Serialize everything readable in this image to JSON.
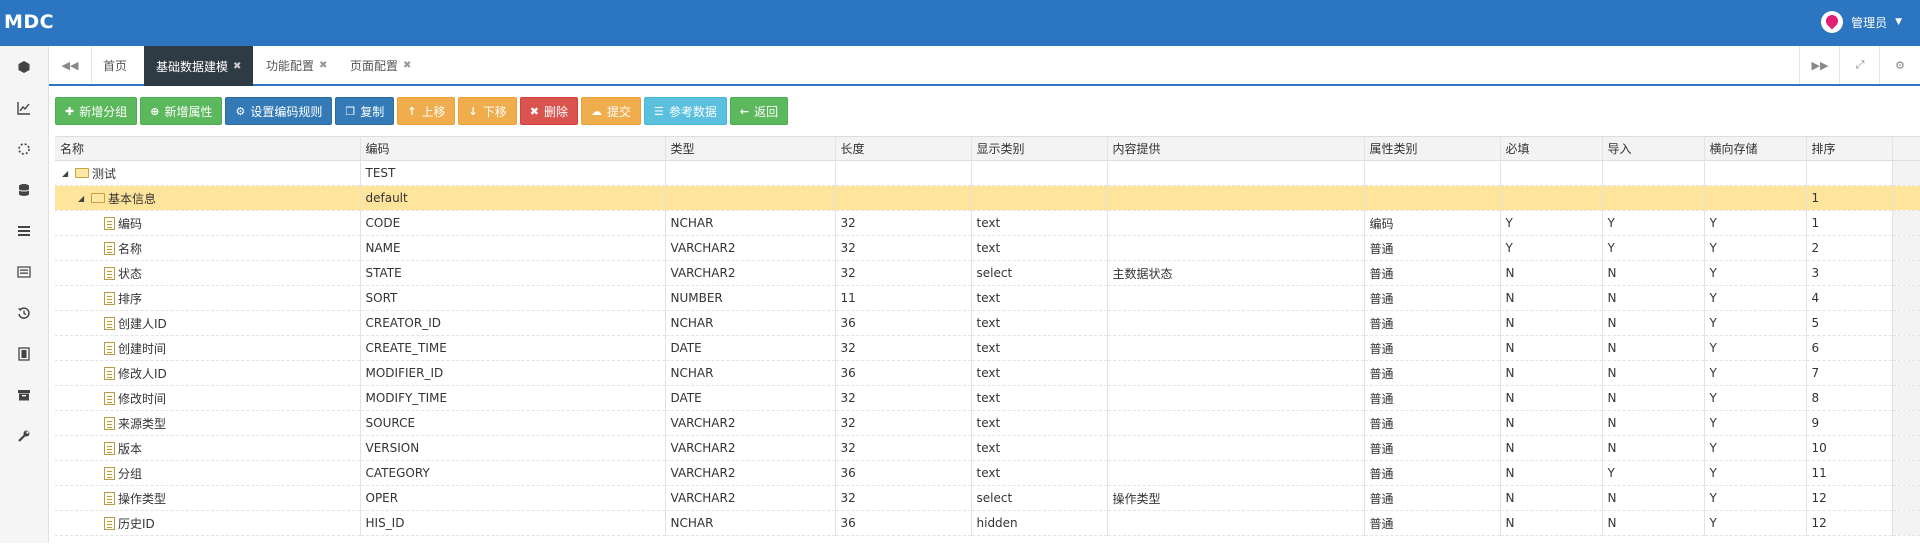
{
  "app": {
    "title": "MDC"
  },
  "user": {
    "name": "管理员",
    "icon": "user-pin-icon"
  },
  "sidebar": {
    "items": [
      {
        "icon": "cube-icon"
      },
      {
        "icon": "line-chart-icon"
      },
      {
        "icon": "spinner-icon"
      },
      {
        "icon": "database-icon"
      },
      {
        "icon": "list-icon"
      },
      {
        "icon": "table-list-icon"
      },
      {
        "icon": "history-icon"
      },
      {
        "icon": "film-icon"
      },
      {
        "icon": "archive-icon"
      },
      {
        "icon": "wrench-icon"
      }
    ]
  },
  "tabs": [
    {
      "label": "首页",
      "closable": false,
      "active": false
    },
    {
      "label": "基础数据建模",
      "closable": true,
      "active": true
    },
    {
      "label": "功能配置",
      "closable": true,
      "active": false
    },
    {
      "label": "页面配置",
      "closable": true,
      "active": false
    }
  ],
  "toolbar": {
    "add_group": "新增分组",
    "add_attr": "新增属性",
    "code_rule": "设置编码规则",
    "copy": "复制",
    "move_up": "上移",
    "move_down": "下移",
    "delete": "删除",
    "submit": "提交",
    "ref_data": "参考数据",
    "back": "返回"
  },
  "grid": {
    "columns": [
      "名称",
      "编码",
      "类型",
      "长度",
      "显示类别",
      "内容提供",
      "属性类别",
      "必填",
      "导入",
      "横向存储",
      "排序"
    ],
    "root": {
      "name": "测试",
      "code": "TEST"
    },
    "group": {
      "name": "基本信息",
      "code": "default",
      "sort": "1"
    },
    "rows": [
      [
        "编码",
        "CODE",
        "NCHAR",
        "32",
        "text",
        "",
        "编码",
        "Y",
        "Y",
        "Y",
        "1"
      ],
      [
        "名称",
        "NAME",
        "VARCHAR2",
        "32",
        "text",
        "",
        "普通",
        "Y",
        "Y",
        "Y",
        "2"
      ],
      [
        "状态",
        "STATE",
        "VARCHAR2",
        "32",
        "select",
        "主数据状态",
        "普通",
        "N",
        "N",
        "Y",
        "3"
      ],
      [
        "排序",
        "SORT",
        "NUMBER",
        "11",
        "text",
        "",
        "普通",
        "N",
        "N",
        "Y",
        "4"
      ],
      [
        "创建人ID",
        "CREATOR_ID",
        "NCHAR",
        "36",
        "text",
        "",
        "普通",
        "N",
        "N",
        "Y",
        "5"
      ],
      [
        "创建时间",
        "CREATE_TIME",
        "DATE",
        "32",
        "text",
        "",
        "普通",
        "N",
        "N",
        "Y",
        "6"
      ],
      [
        "修改人ID",
        "MODIFIER_ID",
        "NCHAR",
        "36",
        "text",
        "",
        "普通",
        "N",
        "N",
        "Y",
        "7"
      ],
      [
        "修改时间",
        "MODIFY_TIME",
        "DATE",
        "32",
        "text",
        "",
        "普通",
        "N",
        "N",
        "Y",
        "8"
      ],
      [
        "来源类型",
        "SOURCE",
        "VARCHAR2",
        "32",
        "text",
        "",
        "普通",
        "N",
        "N",
        "Y",
        "9"
      ],
      [
        "版本",
        "VERSION",
        "VARCHAR2",
        "32",
        "text",
        "",
        "普通",
        "N",
        "N",
        "Y",
        "10"
      ],
      [
        "分组",
        "CATEGORY",
        "VARCHAR2",
        "36",
        "text",
        "",
        "普通",
        "N",
        "Y",
        "Y",
        "11"
      ],
      [
        "操作类型",
        "OPER",
        "VARCHAR2",
        "32",
        "select",
        "操作类型",
        "普通",
        "N",
        "N",
        "Y",
        "12"
      ],
      [
        "历史ID",
        "HIS_ID",
        "NCHAR",
        "36",
        "hidden",
        "",
        "普通",
        "N",
        "N",
        "Y",
        "12"
      ]
    ]
  }
}
